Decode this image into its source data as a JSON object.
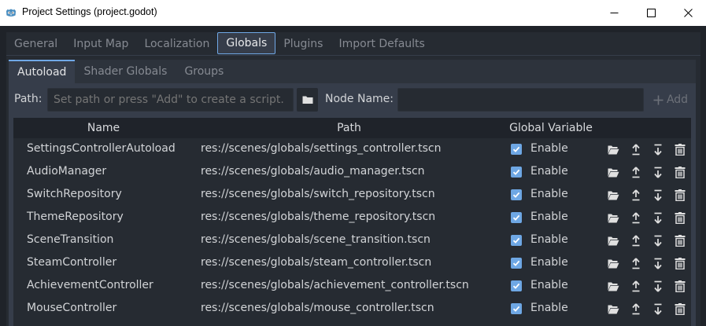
{
  "window": {
    "title": "Project Settings (project.godot)",
    "icons": {
      "app": "godot-logo-icon",
      "minimize": "minimize-icon",
      "maximize": "maximize-icon",
      "close": "close-icon"
    }
  },
  "tabs": [
    {
      "label": "General"
    },
    {
      "label": "Input Map"
    },
    {
      "label": "Localization"
    },
    {
      "label": "Globals",
      "active": true
    },
    {
      "label": "Plugins"
    },
    {
      "label": "Import Defaults"
    }
  ],
  "subtabs": [
    {
      "label": "Autoload",
      "active": true
    },
    {
      "label": "Shader Globals"
    },
    {
      "label": "Groups"
    }
  ],
  "autoload": {
    "path_label": "Path:",
    "path_placeholder": "Set path or press \"Add\" to create a script.",
    "path_value": "",
    "node_name_label": "Node Name:",
    "node_name_value": "",
    "add_label": "Add",
    "icons": {
      "browse": "folder-icon",
      "add": "plus-icon"
    }
  },
  "table": {
    "headers": {
      "name": "Name",
      "path": "Path",
      "global_variable": "Global Variable"
    },
    "enable_label": "Enable",
    "row_icons": [
      "folder-open-icon",
      "move-up-icon",
      "move-down-icon",
      "delete-icon"
    ],
    "rows": [
      {
        "name": "SettingsControllerAutoload",
        "path": "res://scenes/globals/settings_controller.tscn",
        "enabled": true
      },
      {
        "name": "AudioManager",
        "path": "res://scenes/globals/audio_manager.tscn",
        "enabled": true
      },
      {
        "name": "SwitchRepository",
        "path": "res://scenes/globals/switch_repository.tscn",
        "enabled": true
      },
      {
        "name": "ThemeRepository",
        "path": "res://scenes/globals/theme_repository.tscn",
        "enabled": true
      },
      {
        "name": "SceneTransition",
        "path": "res://scenes/globals/scene_transition.tscn",
        "enabled": true
      },
      {
        "name": "SteamController",
        "path": "res://scenes/globals/steam_controller.tscn",
        "enabled": true
      },
      {
        "name": "AchievementController",
        "path": "res://scenes/globals/achievement_controller.tscn",
        "enabled": true
      },
      {
        "name": "MouseController",
        "path": "res://scenes/globals/mouse_controller.tscn",
        "enabled": true
      }
    ]
  },
  "colors": {
    "accent": "#70a8e6",
    "checkbox": "#6ea7e4",
    "panel": "#363d4a",
    "background": "#1f2329"
  }
}
